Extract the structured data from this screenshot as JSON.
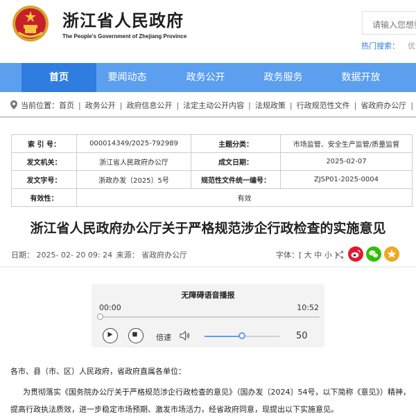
{
  "header": {
    "title": "浙江省人民政府",
    "subtitle": "The People's Government of Zhejiang Province",
    "search_placeholder": "请输入您想要",
    "hot_search_label": "热门搜索：",
    "hot_search_item": "优化营"
  },
  "nav": {
    "items": [
      {
        "label": "首页",
        "active": true
      },
      {
        "label": "要闻动态",
        "active": false
      },
      {
        "label": "政务公开",
        "active": false
      },
      {
        "label": "政务服务",
        "active": false
      },
      {
        "label": "数据开放",
        "active": false
      }
    ]
  },
  "breadcrumb": {
    "prefix": "当前位置：",
    "items": [
      "首页",
      "政务公开",
      "政府信息公开",
      "法定主动公开内容",
      "法规政策",
      "行政规范性文件",
      "省政府办公厅"
    ]
  },
  "info_table": {
    "index_label": "索 引 号：",
    "index_value": "000014349/2025-792989",
    "topic_label": "主题分类：",
    "topic_value": "市场监管、安全生产监管/质量监督",
    "issuer_label": "发文机关：",
    "issuer_value": "浙江省人民政府办公厅",
    "date_label": "成文日期：",
    "date_value": "2025-02-07",
    "docno_label": "发文字号：",
    "docno_value": "浙政办发〔2025〕5号",
    "code_label": "规范性文件统一编号：",
    "code_value": "ZJSP01-2025-0004",
    "validity_label": "有效性：",
    "validity_value": "有效"
  },
  "article": {
    "title": "浙江省人民政府办公厅关于严格规范涉企行政检查的实施意见",
    "date_text": "日期： 2025- 02- 20 09: 24",
    "source_text": "来源： 省政府办公厅",
    "font_size_text": "字体：[ 大  中  小 ]",
    "salutation": "各市、县（市、区）人民政府，省政府直属各单位：",
    "paragraph": "为贯彻落实《国务院办公厅关于严格规范涉企行政检查的意见》（国办发〔2024〕54号，以下简称《意见》）精神，提高行政执法质效，进一步稳定市场预期、激发市场活力，经省政府同意，现提出以下实施意见。"
  },
  "player": {
    "title": "无障碍语音播报",
    "current_time": "00:00",
    "duration": "10:52",
    "speed_label": "倍速",
    "volume": "50",
    "volume_fraction": 0.5
  },
  "social": [
    {
      "icon": "weibo-icon",
      "color": "#e6162d"
    },
    {
      "icon": "wechat-icon",
      "color": "#2dc100"
    },
    {
      "icon": "favorite-icon",
      "color": "#f0a820"
    }
  ],
  "colors": {
    "nav_bg": "#5b9fee",
    "nav_active": "#2f7de0",
    "link_blue": "#2d7fd8"
  }
}
